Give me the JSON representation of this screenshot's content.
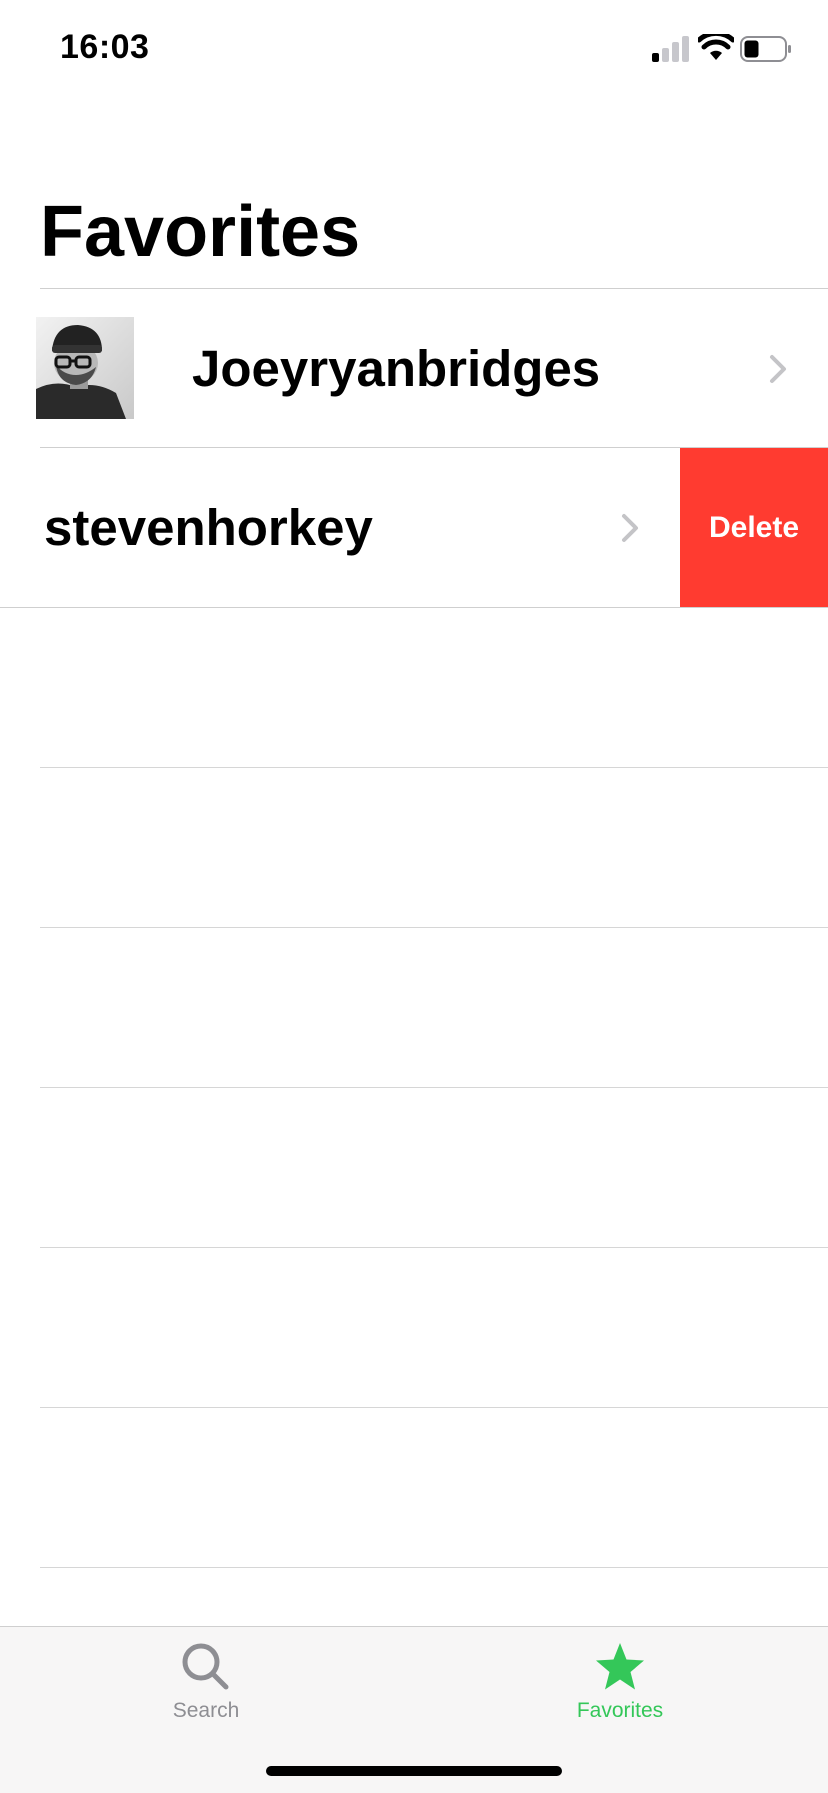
{
  "status_bar": {
    "time": "16:03",
    "icons": [
      "cellular-signal-icon",
      "wifi-icon",
      "battery-icon"
    ],
    "battery_level": 0.35
  },
  "header": {
    "title": "Favorites"
  },
  "favorites": [
    {
      "name": "Joeyryanbridges",
      "has_avatar": true
    },
    {
      "name": "stevenhorkey",
      "has_avatar": false,
      "swipe_action": "Delete"
    }
  ],
  "tab_bar": {
    "tabs": [
      {
        "label": "Search",
        "icon": "search-icon",
        "selected": false
      },
      {
        "label": "Favorites",
        "icon": "star-icon",
        "selected": true
      }
    ]
  },
  "colors": {
    "delete": "#ff3b30",
    "accent": "#34c759",
    "inactive": "#8e8e93"
  }
}
